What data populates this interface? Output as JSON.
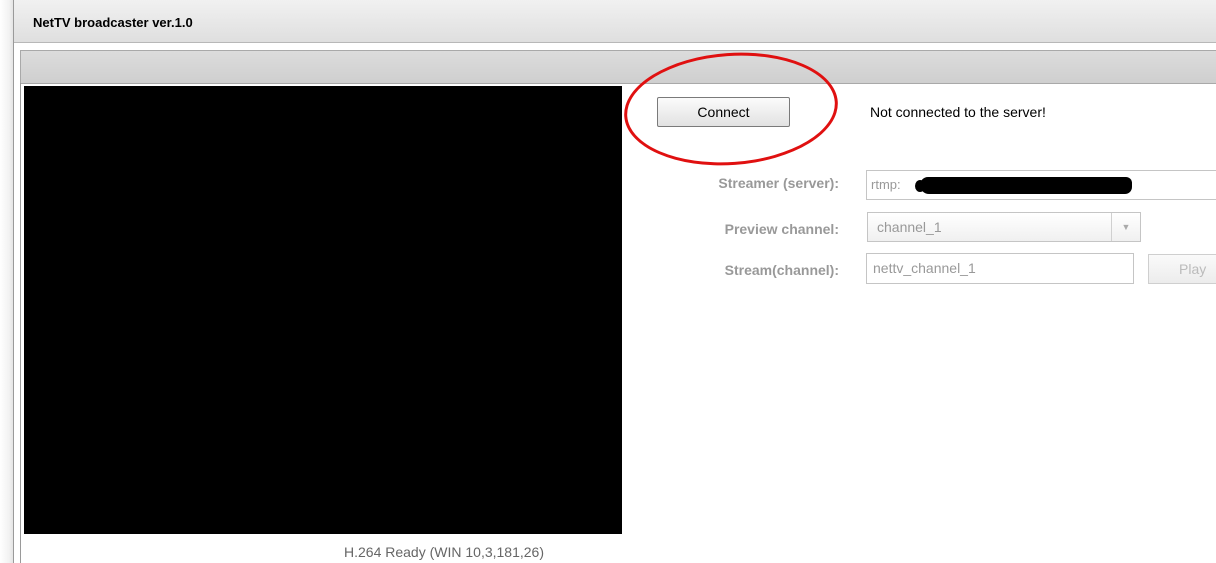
{
  "window": {
    "title": "NetTV broadcaster ver.1.0"
  },
  "video": {
    "status": "H.264 Ready (WIN 10,3,181,26)"
  },
  "connect_button": {
    "label": "Connect"
  },
  "connection_status": "Not connected to the server!",
  "form": {
    "server_label": "Streamer (server):",
    "server_value": "rtmp:",
    "preview_label": "Preview channel:",
    "preview_value": "channel_1",
    "stream_label": "Stream(channel):",
    "stream_value": "nettv_channel_1",
    "play_label": "Play"
  },
  "annotation": {
    "color": "#e01010"
  }
}
